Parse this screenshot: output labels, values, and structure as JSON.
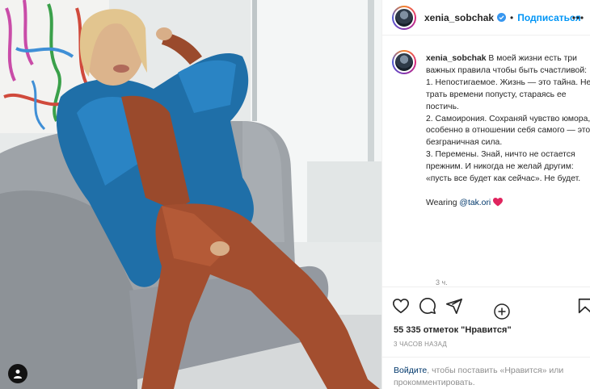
{
  "post": {
    "username": "xenia_sobchak",
    "follow_label": "Подписаться",
    "dot": "•",
    "caption_username": "xenia_sobchak",
    "caption_text": " В моей жизни есть три важных правила чтобы быть счастливой:\n1. Непостигаемое. Жизнь — это тайна. Не трать времени попусту, стараясь ее постичь.\n2. Самоирония. Сохраняй чувство юмора, особенно в отношении себя самого — это безграничная сила.\n3. Перемены. Знай, ничто не остается прежним. И никогда не желай другим: «пусть все будет как сейчас». Не будет.\n\nWearing ",
    "caption_mention": "@tak.ori",
    "caption_time": "3 ч.",
    "likes": "55 335 отметок \"Нравится\"",
    "post_time": "3 ЧАСОВ НАЗАД",
    "login_link": "Войдите",
    "login_text": ", чтобы поставить «Нравится» или прокомментировать."
  },
  "icons": {
    "verified": "verified-badge-icon",
    "more": "more-options-icon",
    "heart": "heart-icon",
    "comment": "comment-icon",
    "share": "share-icon",
    "save": "bookmark-icon",
    "add": "add-comment-icon",
    "tagged_user": "user-tag-icon"
  },
  "colors": {
    "accent": "#0095f6",
    "link": "#00376b",
    "muted": "#8e8e8e",
    "heart_emoji": "#e0245e"
  }
}
